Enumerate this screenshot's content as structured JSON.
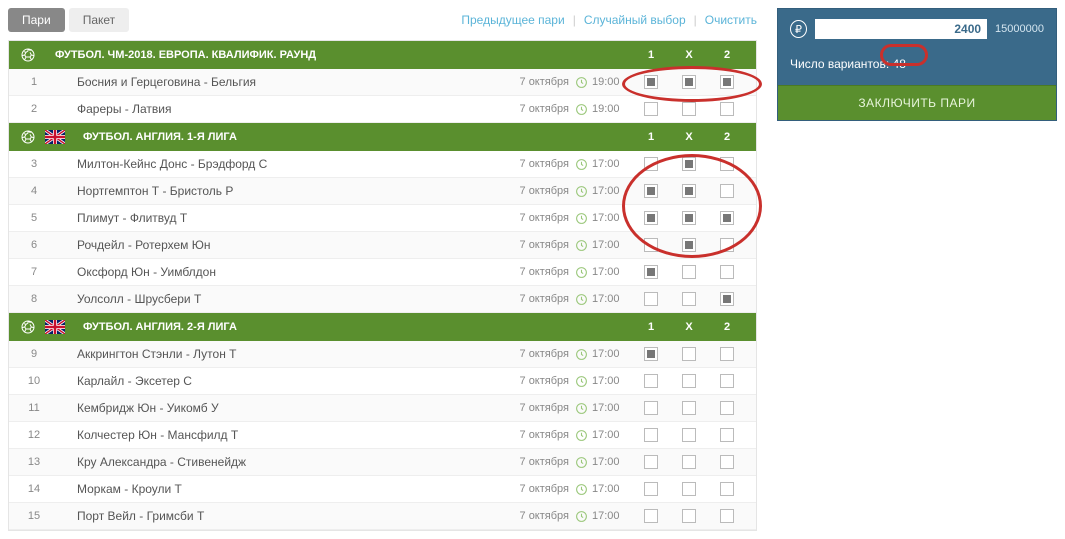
{
  "tabs": {
    "active": "Пари",
    "other": "Пакет"
  },
  "links": {
    "prev": "Предыдущее пари",
    "random": "Случайный выбор",
    "clear": "Очистить"
  },
  "headerCols": [
    "1",
    "X",
    "2"
  ],
  "groups": [
    {
      "title": "ФУТБОЛ. ЧМ-2018. ЕВРОПА. КВАЛИФИК. РАУНД",
      "flag": null,
      "matches": [
        {
          "num": "1",
          "name": "Босния и Герцеговина - Бельгия",
          "date": "7 октября",
          "time": "19:00",
          "sel": [
            true,
            true,
            true
          ]
        },
        {
          "num": "2",
          "name": "Фареры - Латвия",
          "date": "7 октября",
          "time": "19:00",
          "sel": [
            false,
            false,
            false
          ]
        }
      ]
    },
    {
      "title": "ФУТБОЛ. АНГЛИЯ. 1-Я ЛИГА",
      "flag": "uk",
      "matches": [
        {
          "num": "3",
          "name": "Милтон-Кейнс Донс - Брэдфорд С",
          "date": "7 октября",
          "time": "17:00",
          "sel": [
            false,
            true,
            false
          ]
        },
        {
          "num": "4",
          "name": "Нортгемптон Т - Бристоль Р",
          "date": "7 октября",
          "time": "17:00",
          "sel": [
            true,
            true,
            false
          ]
        },
        {
          "num": "5",
          "name": "Плимут - Флитвуд Т",
          "date": "7 октября",
          "time": "17:00",
          "sel": [
            true,
            true,
            true
          ]
        },
        {
          "num": "6",
          "name": "Рочдейл - Ротерхем Юн",
          "date": "7 октября",
          "time": "17:00",
          "sel": [
            false,
            true,
            false
          ]
        },
        {
          "num": "7",
          "name": "Оксфорд Юн - Уимблдон",
          "date": "7 октября",
          "time": "17:00",
          "sel": [
            true,
            false,
            false
          ]
        },
        {
          "num": "8",
          "name": "Уолсолл - Шрусбери Т",
          "date": "7 октября",
          "time": "17:00",
          "sel": [
            false,
            false,
            true
          ]
        }
      ]
    },
    {
      "title": "ФУТБОЛ. АНГЛИЯ. 2-Я ЛИГА",
      "flag": "uk",
      "matches": [
        {
          "num": "9",
          "name": "Аккрингтон Стэнли - Лутон Т",
          "date": "7 октября",
          "time": "17:00",
          "sel": [
            true,
            false,
            false
          ]
        },
        {
          "num": "10",
          "name": "Карлайл - Эксетер С",
          "date": "7 октября",
          "time": "17:00",
          "sel": [
            false,
            false,
            false
          ]
        },
        {
          "num": "11",
          "name": "Кембридж Юн - Уикомб У",
          "date": "7 октября",
          "time": "17:00",
          "sel": [
            false,
            false,
            false
          ]
        },
        {
          "num": "12",
          "name": "Колчестер Юн - Мансфилд Т",
          "date": "7 октября",
          "time": "17:00",
          "sel": [
            false,
            false,
            false
          ]
        },
        {
          "num": "13",
          "name": "Кру Александра - Стивенейдж",
          "date": "7 октября",
          "time": "17:00",
          "sel": [
            false,
            false,
            false
          ]
        },
        {
          "num": "14",
          "name": "Моркам - Кроули Т",
          "date": "7 октября",
          "time": "17:00",
          "sel": [
            false,
            false,
            false
          ]
        },
        {
          "num": "15",
          "name": "Порт Вейл - Гримсби Т",
          "date": "7 октября",
          "time": "17:00",
          "sel": [
            false,
            false,
            false
          ]
        }
      ]
    }
  ],
  "slip": {
    "currency": "₽",
    "stake": "2400",
    "maxStake": "15000000",
    "variantsLabel": "Число вариантов:",
    "variantsCount": "48",
    "submit": "ЗАКЛЮЧИТЬ ПАРИ"
  }
}
